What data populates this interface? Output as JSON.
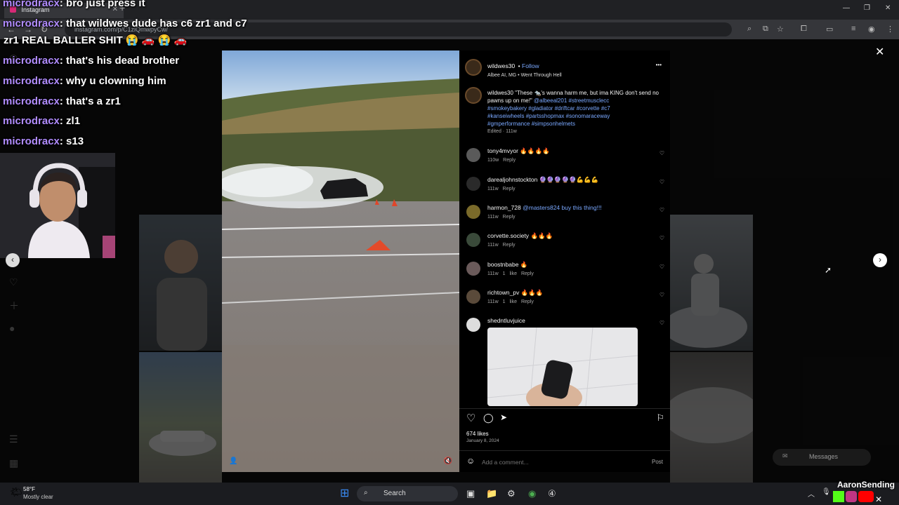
{
  "browser": {
    "tab_title": "Instagram",
    "url": "instagram.com/p/C1zlQmwpyCw/",
    "minimize": "—",
    "maximize": "❐",
    "close": "✕"
  },
  "chat": [
    {
      "user": "microdracx",
      "msg": ": bro just press it"
    },
    {
      "user": "microdracx",
      "msg": ": that wildwes dude has c6 zr1 and c7"
    },
    {
      "user": "",
      "msg": "zr1 REAL BALLER SHIT 😭 🚗 😭 🚗"
    },
    {
      "user": "microdracx",
      "msg": ": that's his dead brother"
    },
    {
      "user": "microdracx",
      "msg": ": why u clowning him"
    },
    {
      "user": "microdracx",
      "msg": ": that's a zr1"
    },
    {
      "user": "microdracx",
      "msg": ": zl1"
    },
    {
      "user": "microdracx",
      "msg": ": s13"
    }
  ],
  "post": {
    "username": "wildwes30",
    "follow_label": "Follow",
    "location": "Albee AI, MG • Went Through Hell",
    "more_icon": "•••",
    "caption_user": "wildwes30",
    "caption_text": "\"These 🐀's wanna harm me, but ima KING don't send no pawns up on me!\"",
    "caption_tags_1": "@albeeal201 #streetmusclecc",
    "caption_tags_2": "#smokeybakery #gladiator #driftcar #corvette #c7",
    "caption_tags_3": "#kanseiwheels #partsshopmax #sonomaraceway",
    "caption_tags_4": "#gmperformance #simpsonhelmets",
    "caption_meta": "Edited · 111w",
    "likes": "674 likes",
    "date": "January 8, 2024",
    "add_comment_placeholder": "Add a comment...",
    "post_label": "Post"
  },
  "comments": [
    {
      "user": "tony4mvyor",
      "text": "🔥🔥🔥🔥",
      "age": "110w",
      "likes": "",
      "reply": "Reply"
    },
    {
      "user": "darealjohnstockton",
      "text": "🔮🔮🔮🔮🔮💪💪💪",
      "age": "111w",
      "likes": "",
      "reply": "Reply"
    },
    {
      "user": "harmon_728",
      "text": "@masters824 buy this thing!!!",
      "age": "111w",
      "likes": "",
      "reply": "Reply"
    },
    {
      "user": "corvette.society",
      "text": "🔥🔥🔥",
      "age": "111w",
      "likes": "",
      "reply": "Reply"
    },
    {
      "user": "boostnbabe",
      "text": "🔥",
      "age": "111w",
      "likes": "1 like",
      "reply": "Reply"
    },
    {
      "user": "richtown_pv",
      "text": "🔥🔥🔥",
      "age": "111w",
      "likes": "1 like",
      "reply": "Reply"
    },
    {
      "user": "shedntluvjuice",
      "text": "",
      "age": "",
      "likes": "",
      "reply": ""
    }
  ],
  "messages_label": "Messages",
  "taskbar": {
    "weather_temp": "58°F",
    "weather_desc": "Mostly clear",
    "search_label": "Search"
  },
  "streamer_brand": "AaronSending",
  "colors": {
    "chat_user": "#b18cff",
    "link": "#7aa8ff",
    "ig_bg": "#000000"
  }
}
